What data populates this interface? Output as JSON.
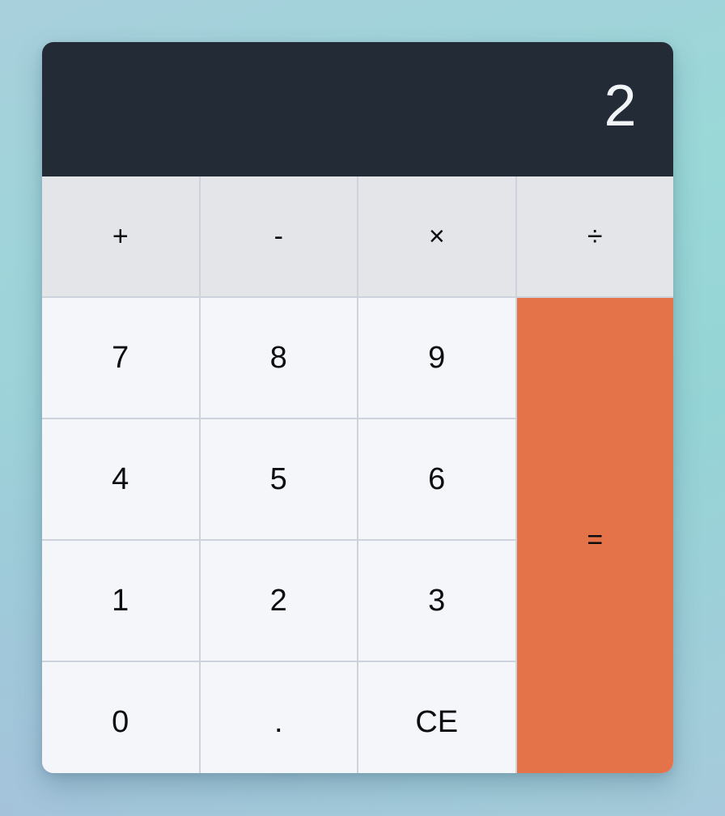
{
  "app": {
    "name": "calculator"
  },
  "display": {
    "value": "2",
    "background_color": "#232b36",
    "text_color": "#f2f5f8"
  },
  "theme": {
    "page_background_from": "#a8cfdc",
    "page_background_to": "#9ad8d8",
    "key_background": "#f4f6fa",
    "operator_background": "#e3e5e9",
    "accent_color": "#e5734a",
    "divider_color": "#ccd3dc",
    "key_text_color": "#0c0d0f"
  },
  "keypad": {
    "operators": [
      {
        "label": "+",
        "name": "add"
      },
      {
        "label": "-",
        "name": "subtract"
      },
      {
        "label": "×",
        "name": "multiply"
      },
      {
        "label": "÷",
        "name": "divide"
      }
    ],
    "rows": [
      [
        {
          "label": "7",
          "name": "digit-7"
        },
        {
          "label": "8",
          "name": "digit-8"
        },
        {
          "label": "9",
          "name": "digit-9"
        }
      ],
      [
        {
          "label": "4",
          "name": "digit-4"
        },
        {
          "label": "5",
          "name": "digit-5"
        },
        {
          "label": "6",
          "name": "digit-6"
        }
      ],
      [
        {
          "label": "1",
          "name": "digit-1"
        },
        {
          "label": "2",
          "name": "digit-2"
        },
        {
          "label": "3",
          "name": "digit-3"
        }
      ],
      [
        {
          "label": "0",
          "name": "digit-0"
        },
        {
          "label": ".",
          "name": "decimal-point"
        },
        {
          "label": "CE",
          "name": "clear-entry"
        }
      ]
    ],
    "equals": {
      "label": "=",
      "name": "equals"
    }
  }
}
